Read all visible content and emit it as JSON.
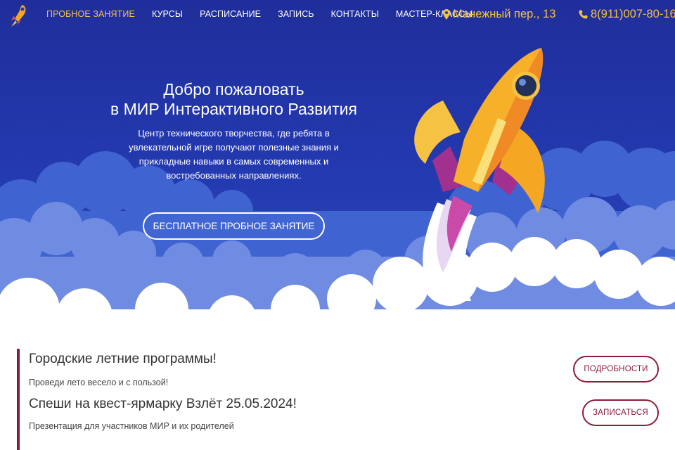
{
  "colors": {
    "hero_bg": "#2338ad",
    "accent_yellow": "#f5c242",
    "promo_accent": "#8c1c3a"
  },
  "nav": {
    "logo_icon": "rocket-logo-icon",
    "items": [
      {
        "label": "ПРОБНОЕ ЗАНЯТИЕ",
        "active": true
      },
      {
        "label": "КУРСЫ",
        "active": false
      },
      {
        "label": "РАСПИСАНИЕ",
        "active": false
      },
      {
        "label": "ЗАПИСЬ",
        "active": false
      },
      {
        "label": "КОНТАКТЫ",
        "active": false
      },
      {
        "label": "МАСТЕР-КЛАССЫ",
        "active": false
      }
    ],
    "address": {
      "icon": "map-marker-icon",
      "text": "Манежный пер., 13"
    },
    "phone": {
      "icon": "phone-icon",
      "text": "8(911)007-80-16"
    }
  },
  "hero": {
    "title_line1": "Добро пожаловать",
    "title_line2": "в МИР Интерактивного Развития",
    "description": "Центр технического творчества, где ребята в увлекательной игре получают полезные знания и прикладные навыки в самых современных и востребованных направлениях.",
    "cta_label": "БЕСПЛАТНОЕ ПРОБНОЕ ЗАНЯТИЕ",
    "illustration": "rocket-illustration"
  },
  "promos": [
    {
      "title": "Городские летние программы!",
      "subtitle": "Проведи лето весело и с пользой!",
      "button_label": "ПОДРОБНОСТИ"
    },
    {
      "title": "Спеши на квест-ярмарку Взлёт 25.05.2024!",
      "subtitle": "Презентация для участников МИР и их родителей",
      "button_label": "ЗАПИСАТЬСЯ"
    }
  ]
}
